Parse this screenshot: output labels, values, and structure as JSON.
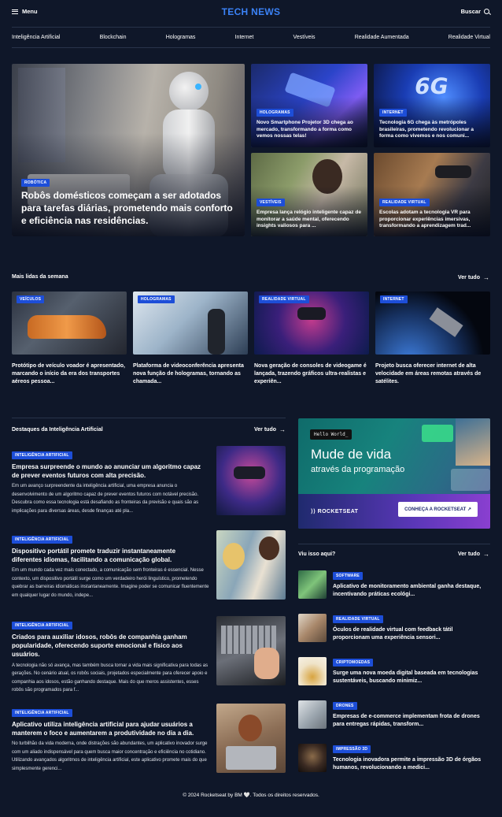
{
  "header": {
    "menu_label": "Menu",
    "logo": "TECH NEWS",
    "search_label": "Buscar"
  },
  "nav": [
    "Inteligência Artificial",
    "Blockchain",
    "Hologramas",
    "Internet",
    "Vestíveis",
    "Realidade Aumentada",
    "Realidade Virtual"
  ],
  "hero": {
    "main": {
      "tag": "Robótica",
      "title": "Robôs domésticos começam a ser adotados para tarefas diárias, prometendo mais conforto e eficiência nas residências."
    },
    "cards": [
      {
        "tag": "Hologramas",
        "title": "Novo Smartphone Projetor 3D chega ao mercado, transformando a forma como vemos nossas telas!"
      },
      {
        "tag": "Internet",
        "title": "Tecnologia 6G chega às metrópoles brasileiras, prometendo revolucionar a forma como vivemos e nos comuni..."
      },
      {
        "tag": "Vestíveis",
        "title": "Empresa lança relógio inteligente capaz de monitorar a saúde mental, oferecendo insights valiosos para ..."
      },
      {
        "tag": "Realidade Virtual",
        "title": "Escolas adotam a tecnologia VR para proporcionar experiências imersivas, transformando a aprendizagem trad..."
      }
    ]
  },
  "weekly": {
    "title": "Mais lidas da semana",
    "see_all": "Ver tudo",
    "items": [
      {
        "tag": "Veículos",
        "title": "Protótipo de veículo voador é apresentado, marcando o início da era dos transportes aéreos pessoa..."
      },
      {
        "tag": "Hologramas",
        "title": "Plataforma de videoconferência apresenta nova função de hologramas, tornando as chamada..."
      },
      {
        "tag": "Realidade Virtual",
        "title": "Nova geração de consoles de videogame é lançada, trazendo gráficos ultra-realistas e experiên..."
      },
      {
        "tag": "Internet",
        "title": "Projeto busca oferecer internet de alta velocidade em áreas remotas através de satélites."
      }
    ]
  },
  "ai": {
    "title": "Destaques da Inteligência Artificial",
    "see_all": "Ver tudo",
    "articles": [
      {
        "tag": "Inteligência Artificial",
        "title": "Empresa surpreende o mundo ao anunciar um algoritmo capaz de prever eventos futuros com alta precisão.",
        "desc": "Em um avanço surpreendente da inteligência artificial, uma empresa anuncia o desenvolvimento de um algoritmo capaz de prever eventos futuros com notável precisão. Descubra como essa tecnologia está desafiando as fronteiras da previsão e quais são as implicações para diversas áreas, desde finanças até pla..."
      },
      {
        "tag": "Inteligência Artificial",
        "title": "Dispositivo portátil promete traduzir instantaneamente diferentes idiomas, facilitando a comunicação global.",
        "desc": "Em um mundo cada vez mais conectado, a comunicação sem fronteiras é essencial. Nesse contexto, um dispositivo portátil surge como um verdadeiro herói linguístico, prometendo quebrar as barreiras idiomáticas instantaneamente. Imagine poder se comunicar fluentemente em qualquer lugar do mundo, indepe..."
      },
      {
        "tag": "Inteligência Artificial",
        "title": "Criados para auxiliar idosos, robôs de companhia ganham popularidade, oferecendo suporte emocional e físico aos usuários.",
        "desc": "A tecnologia não só avança, mas também busca tornar a vida mais significativa para todas as gerações. No cenário atual, os robôs sociais, projetados especialmente para oferecer apoio e companhia aos idosos, estão ganhando destaque. Mais do que meros assistentes, esses robôs são programados para f..."
      },
      {
        "tag": "Inteligência Artificial",
        "title": "Aplicativo utiliza inteligência artificial para ajudar usuários a manterem o foco e aumentarem a produtividade no dia a dia.",
        "desc": "No turbilhão da vida moderna, onde distrações são abundantes, um aplicativo inovador surge com um aliado indispensável para quem busca maior concentração e eficiência no cotidiano. Utilizando avançados algoritmos de inteligência artificial, este aplicativo promete mais do que simplesmente gerenci..."
      }
    ]
  },
  "banner": {
    "code": "Hello World_",
    "headline": "Mude de vida",
    "subline": "através da programação",
    "brand": "ROCKETSEAT",
    "cta": "CONHEÇA A ROCKETSEAT"
  },
  "seen": {
    "title": "Viu isso aqui?",
    "see_all": "Ver tudo",
    "items": [
      {
        "tag": "Software",
        "title": "Aplicativo de monitoramento ambiental ganha destaque, incentivando práticas ecológi..."
      },
      {
        "tag": "Realidade Virtual",
        "title": "Óculos de realidade virtual com feedback tátil proporcionam uma experiência sensori..."
      },
      {
        "tag": "Criptomoedas",
        "title": "Surge uma nova moeda digital baseada em tecnologias sustentáveis, buscando minimiz..."
      },
      {
        "tag": "Drones",
        "title": "Empresas de e-commerce implementam frota de drones para entregas rápidas, transform..."
      },
      {
        "tag": "Impressão 3D",
        "title": "Tecnologia inovadora permite a impressão 3D de órgãos humanos, revolucionando a medici..."
      }
    ]
  },
  "footer": {
    "text": "© 2024 Rocketseat by BM 🤍. Todos os direitos reservados."
  }
}
